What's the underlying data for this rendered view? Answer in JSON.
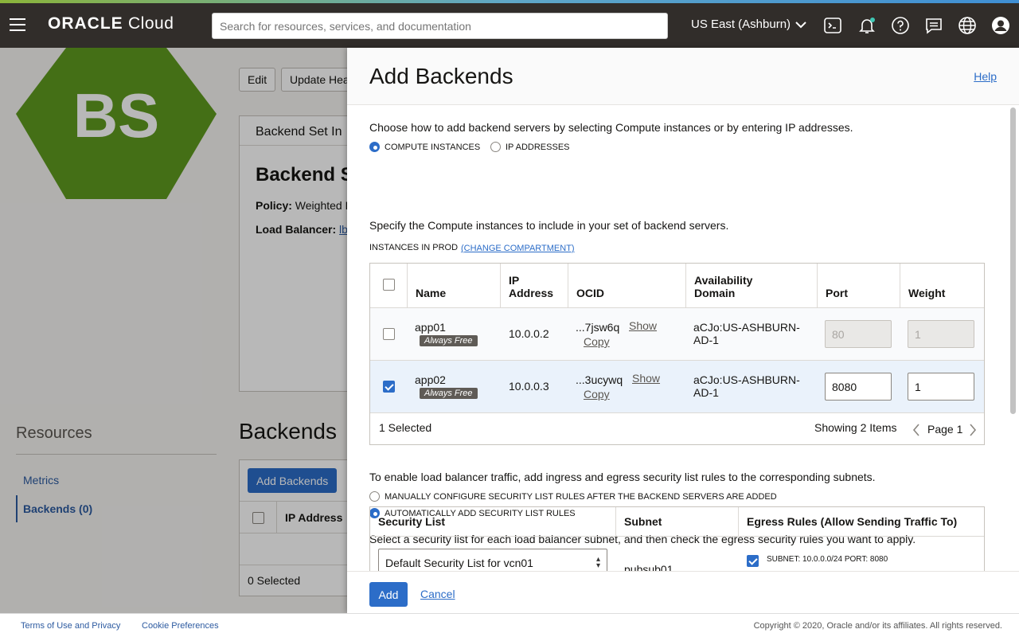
{
  "topbar": {
    "logo_brand": "ORACLE",
    "logo_product": "Cloud",
    "search_placeholder": "Search for resources, services, and documentation",
    "region": "US East (Ashburn)"
  },
  "background": {
    "avatar_initials": "BS",
    "buttons": {
      "edit": "Edit",
      "update_health": "Update Hea"
    },
    "card": {
      "tab_label": "Backend Set In",
      "title": "Backend S",
      "policy_label": "Policy:",
      "policy_value": "Weighted R",
      "lb_label": "Load Balancer:",
      "lb_value": "lb"
    },
    "resources": {
      "heading": "Resources",
      "items": [
        {
          "label": "Metrics"
        },
        {
          "label": "Backends (0)"
        }
      ]
    },
    "backends": {
      "heading": "Backends",
      "add_button": "Add Backends",
      "col_ip": "IP Address",
      "selected": "0 Selected"
    }
  },
  "panel": {
    "title": "Add Backends",
    "help": "Help",
    "intro": "Choose how to add backend servers by selecting Compute instances or by entering IP addresses.",
    "mode_options": [
      {
        "label": "COMPUTE INSTANCES",
        "selected": true
      },
      {
        "label": "IP ADDRESSES",
        "selected": false
      }
    ],
    "specify": "Specify the Compute instances to include in your set of backend servers.",
    "instances_in": "INSTANCES IN PROD",
    "change_compartment": "(CHANGE COMPARTMENT)",
    "table": {
      "headers": {
        "name": "Name",
        "ip_1": "IP",
        "ip_2": "Address",
        "ocid": "OCID",
        "ad_1": "Availability",
        "ad_2": "Domain",
        "port": "Port",
        "weight": "Weight"
      },
      "rows": [
        {
          "name": "app01",
          "badge": "Always Free",
          "ip": "10.0.0.2",
          "ocid": "...7jsw6q",
          "show": "Show",
          "copy": "Copy",
          "ad_1": "aCJo:US-ASHBURN-",
          "ad_2": "AD-1",
          "port": "80",
          "weight": "1",
          "checked": false
        },
        {
          "name": "app02",
          "badge": "Always Free",
          "ip": "10.0.0.3",
          "ocid": "...3ucywq",
          "show": "Show",
          "copy": "Copy",
          "ad_1": "aCJo:US-ASHBURN-",
          "ad_2": "AD-1",
          "port": "8080",
          "weight": "1",
          "checked": true
        }
      ],
      "selected_count": "1 Selected",
      "showing": "Showing 2 Items",
      "page": "Page 1"
    },
    "security_intro": "To enable load balancer traffic, add ingress and egress security list rules to the corresponding subnets.",
    "security_options": [
      {
        "label": "MANUALLY CONFIGURE SECURITY LIST RULES AFTER THE BACKEND SERVERS ARE ADDED",
        "selected": false
      },
      {
        "label": "AUTOMATICALLY ADD SECURITY LIST RULES",
        "selected": true
      }
    ],
    "security_select_text": "Select a security list for each load balancer subnet, and then check the egress security rules you want to apply.",
    "security_table": {
      "headers": {
        "list": "Security List",
        "subnet": "Subnet",
        "egress": "Egress Rules (Allow Sending Traffic To)"
      },
      "row": {
        "list_value": "Default Security List for vcn01",
        "subnet": "pubsub01",
        "egress_rule": "SUBNET: 10.0.0.0/24 PORT: 8080"
      }
    },
    "footer": {
      "add": "Add",
      "cancel": "Cancel"
    }
  },
  "footer": {
    "terms": "Terms of Use and Privacy",
    "cookies": "Cookie Preferences",
    "copyright": "Copyright © 2020, Oracle and/or its affiliates. All rights reserved."
  },
  "colors": {
    "topbar": "#312d2a",
    "accent": "#2c6dc8",
    "avatar": "#5f9a1f"
  }
}
